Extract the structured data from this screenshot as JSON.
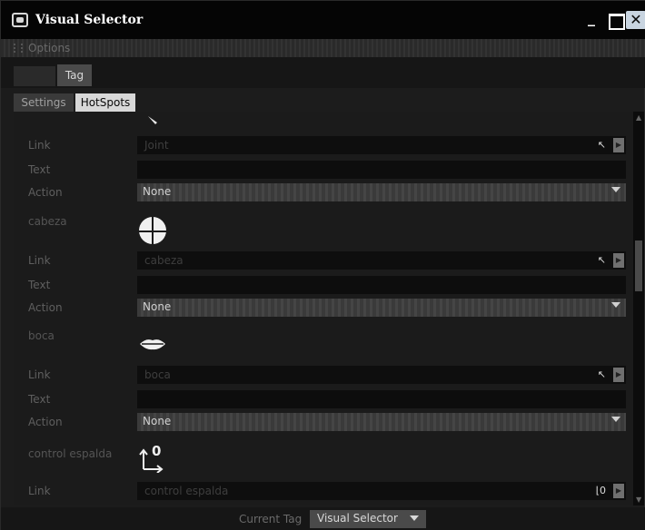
{
  "window": {
    "title": "Visual Selector"
  },
  "menubar": {
    "options_label": "Options"
  },
  "tabs": {
    "tag_label": "Tag"
  },
  "subtabs": {
    "settings_label": "Settings",
    "hotspots_label": "HotSpots"
  },
  "labels": {
    "link": "Link",
    "text": "Text",
    "action": "Action"
  },
  "hotspots": [
    {
      "name": "",
      "link_value": "Joint",
      "text_value": "",
      "action_value": "None",
      "icon": "arrow-glyph"
    },
    {
      "name": "cabeza",
      "link_value": "cabeza",
      "text_value": "",
      "action_value": "None",
      "icon": "sphere-glyph"
    },
    {
      "name": "boca",
      "link_value": "boca",
      "text_value": "",
      "action_value": "None",
      "icon": "lips-glyph"
    },
    {
      "name": "control espalda",
      "link_value": "control espalda",
      "text_value": "",
      "action_value": "",
      "icon": "axis-glyph"
    }
  ],
  "footer": {
    "current_tag_label": "Current Tag",
    "current_tag_value": "Visual Selector"
  },
  "colors": {
    "background": "#1b1b1b",
    "titlebar": "#050505",
    "active_tab": "#d8d8d8",
    "action_dropdown": "#3a3a3a"
  }
}
